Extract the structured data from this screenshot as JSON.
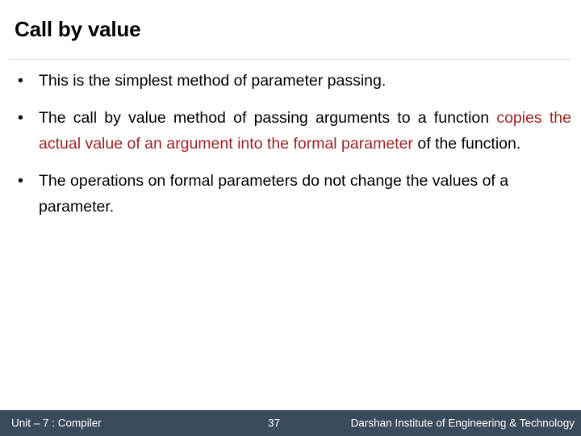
{
  "slide": {
    "title": "Call by value",
    "bullets": [
      {
        "marker": "•",
        "justified": false,
        "segments": [
          {
            "text": "This is the simplest method of parameter passing.",
            "color": "black"
          }
        ]
      },
      {
        "marker": "•",
        "justified": true,
        "segments": [
          {
            "text": "The call by value method of passing arguments to a function ",
            "color": "black"
          },
          {
            "text": "copies the actual value of an argument into the formal parameter",
            "color": "red"
          },
          {
            "text": " of the function.",
            "color": "black"
          }
        ]
      },
      {
        "marker": "•",
        "justified": false,
        "segments": [
          {
            "text": "The operations on formal parameters do not change the values of a parameter.",
            "color": "black"
          }
        ]
      }
    ]
  },
  "footer": {
    "unit": "Unit – 7 : Compiler",
    "page_number": "37",
    "institute": "Darshan Institute of Engineering & Technology"
  },
  "colors": {
    "accent_red": "#9C2323",
    "footer_background": "#3A4B5C",
    "rule": "#d8d8d8",
    "text": "#000000",
    "footer_text": "#ffffff"
  }
}
